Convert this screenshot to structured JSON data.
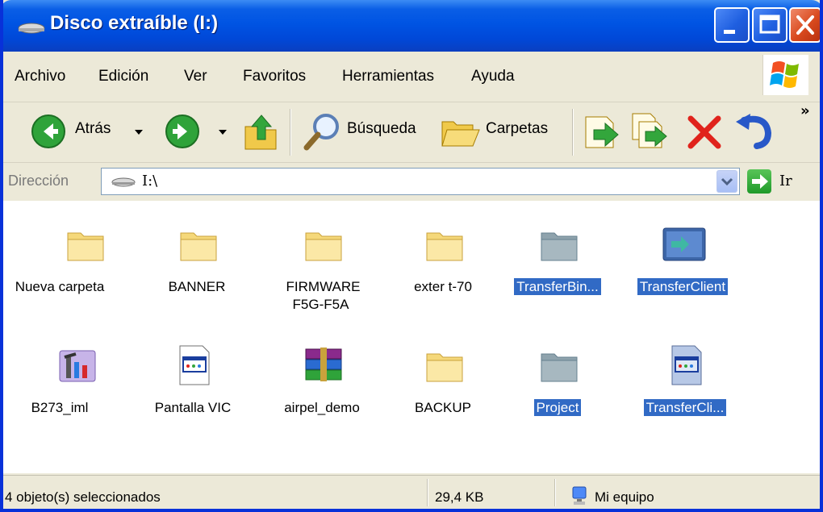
{
  "window": {
    "title": "Disco extraíble (I:)"
  },
  "menu": [
    "Archivo",
    "Edición",
    "Ver",
    "Favoritos",
    "Herramientas",
    "Ayuda"
  ],
  "toolbar": {
    "back_label": "Atrás",
    "search_label": "Búsqueda",
    "folders_label": "Carpetas",
    "overflow": "»"
  },
  "address": {
    "label": "Dirección",
    "value": "I:\\",
    "go_label": "Ir"
  },
  "items": [
    {
      "name": "Nueva carpeta",
      "type": "folder",
      "selected": false
    },
    {
      "name": "BANNER",
      "type": "folder",
      "selected": false
    },
    {
      "name": "FIRMWARE F5G-F5A",
      "type": "folder",
      "selected": false
    },
    {
      "name": "exter t-70",
      "type": "folder",
      "selected": false
    },
    {
      "name": "TransferBin...",
      "type": "folder",
      "selected": true
    },
    {
      "name": "TransferClient",
      "type": "app",
      "selected": true
    },
    {
      "name": "B273_iml",
      "type": "tool",
      "selected": false
    },
    {
      "name": "Pantalla VIC",
      "type": "exe",
      "selected": false
    },
    {
      "name": "airpel_demo",
      "type": "archive",
      "selected": false
    },
    {
      "name": "BACKUP",
      "type": "folder",
      "selected": false
    },
    {
      "name": "Project",
      "type": "folder",
      "selected": true
    },
    {
      "name": "TransferCli...",
      "type": "exe",
      "selected": true
    }
  ],
  "status": {
    "selection": "4 objeto(s) seleccionados",
    "size": "29,4 KB",
    "location": "Mi equipo"
  },
  "colors": {
    "title_blue": "#0054e3",
    "selection": "#316ac5",
    "folder_yellow": "#f5d87a"
  }
}
